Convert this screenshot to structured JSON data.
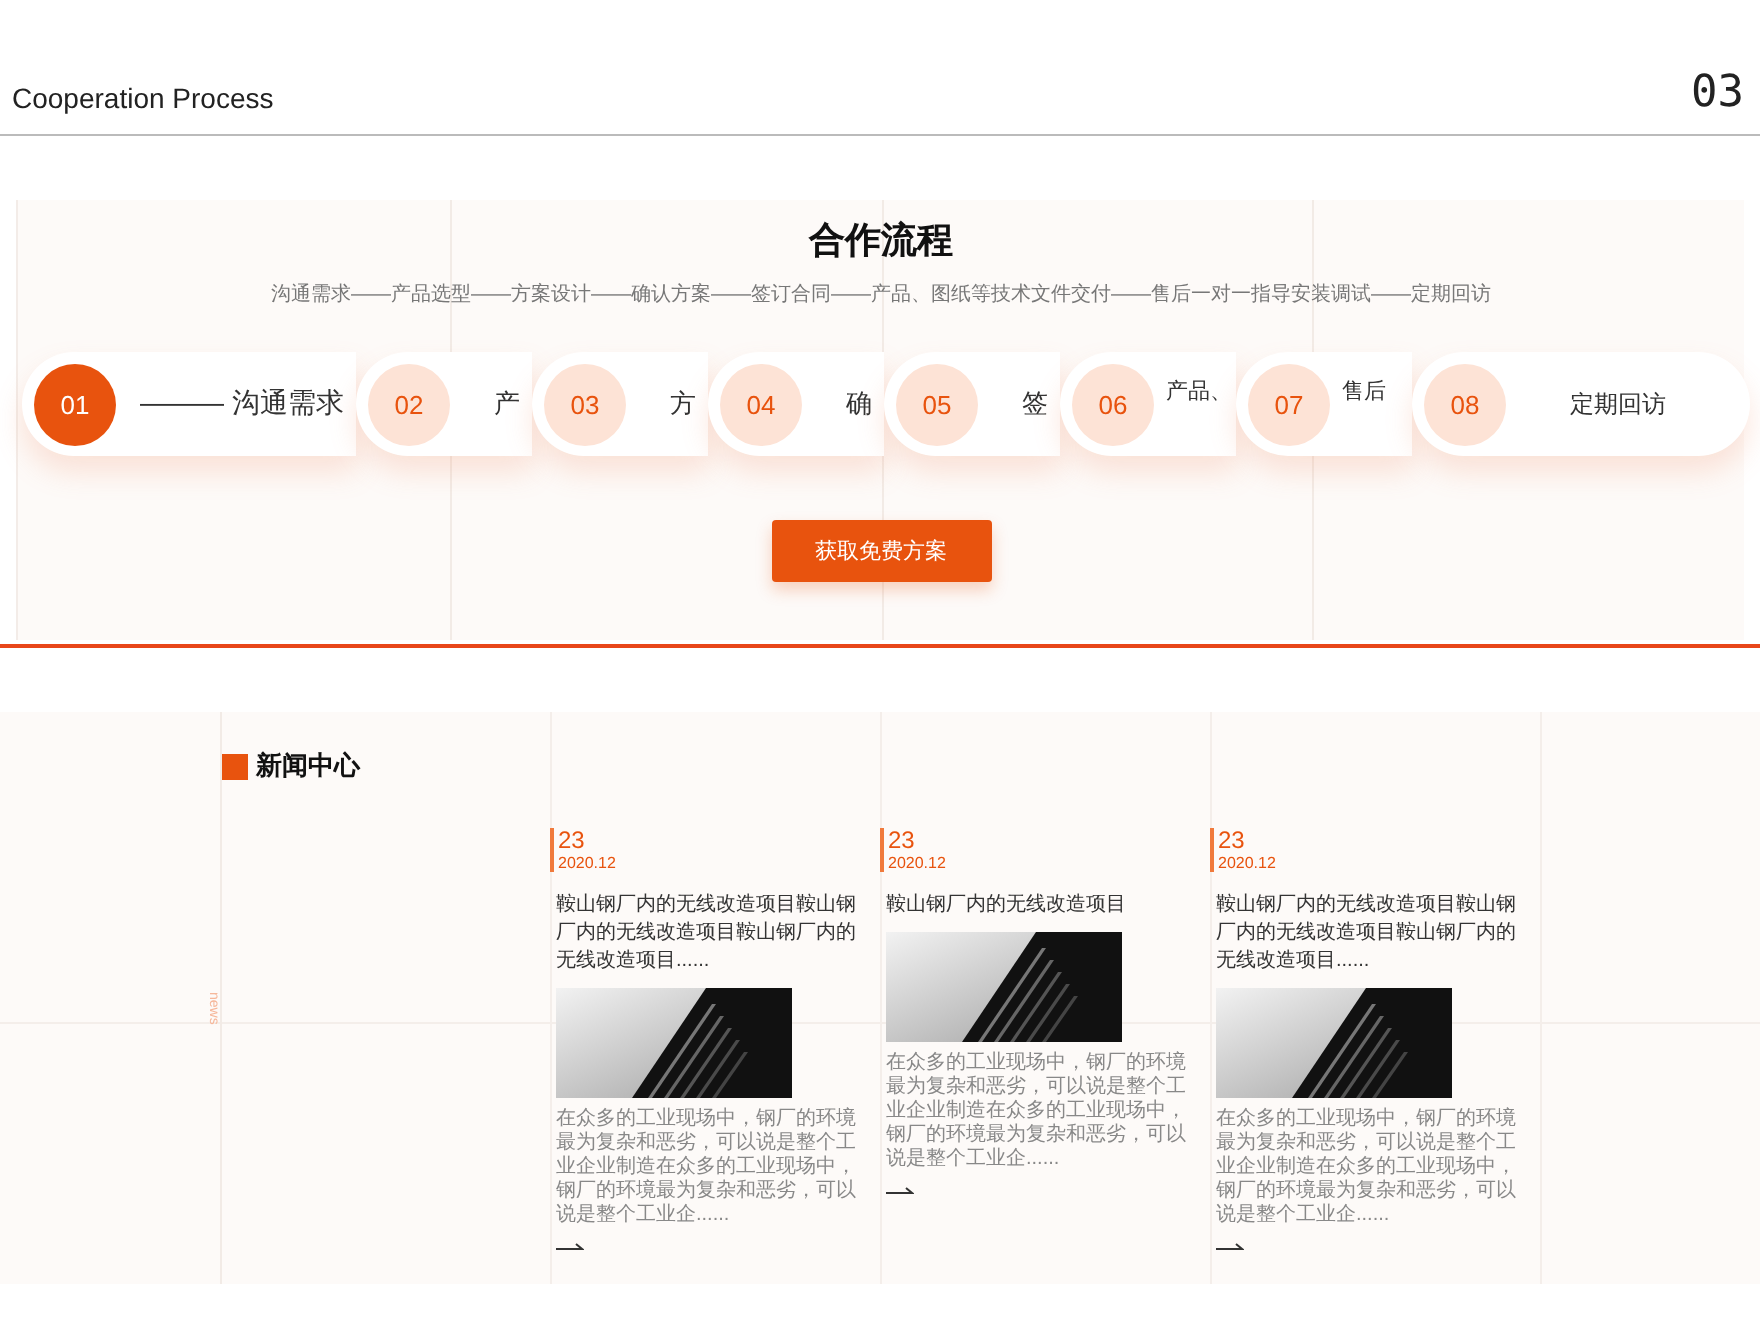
{
  "header": {
    "title": "Cooperation Process",
    "page_number": "03"
  },
  "process": {
    "title": "合作流程",
    "subtitle": "沟通需求——产品选型——方案设计——确认方案——签订合同——产品、图纸等技术文件交付——售后一对一指导安装调试——定期回访",
    "steps": [
      {
        "number": "01",
        "label": "——— 沟通需求",
        "selected": true
      },
      {
        "number": "02",
        "label": "产",
        "selected": false
      },
      {
        "number": "03",
        "label": "方",
        "selected": false
      },
      {
        "number": "04",
        "label": "确",
        "selected": false
      },
      {
        "number": "05",
        "label": "签",
        "selected": false
      },
      {
        "number": "06",
        "label": "产品、",
        "selected": false
      },
      {
        "number": "07",
        "label": "售后",
        "selected": false
      },
      {
        "number": "08",
        "label": "定期回访",
        "selected": false
      }
    ],
    "button": "获取免费方案"
  },
  "news": {
    "title": "新闻中心",
    "side_label": "news",
    "items": [
      {
        "day": "23",
        "month": "2020.12",
        "title": "鞍山钢厂内的无线改造项目鞍山钢厂内的无线改造项目鞍山钢厂内的无线改造项目......",
        "excerpt": "在众多的工业现场中，钢厂的环境最为复杂和恶劣，可以说是整个工业企业制造在众多的工业现场中，钢厂的环境最为复杂和恶劣，可以说是整个工业企......"
      },
      {
        "day": "23",
        "month": "2020.12",
        "title": "鞍山钢厂内的无线改造项目",
        "excerpt": "在众多的工业现场中，钢厂的环境最为复杂和恶劣，可以说是整个工业企业制造在众多的工业现场中，钢厂的环境最为复杂和恶劣，可以说是整个工业企......"
      },
      {
        "day": "23",
        "month": "2020.12",
        "title": "鞍山钢厂内的无线改造项目鞍山钢厂内的无线改造项目鞍山钢厂内的无线改造项目......",
        "excerpt": "在众多的工业现场中，钢厂的环境最为复杂和恶劣，可以说是整个工业企业制造在众多的工业现场中，钢厂的环境最为复杂和恶劣，可以说是整个工业企......"
      }
    ]
  }
}
